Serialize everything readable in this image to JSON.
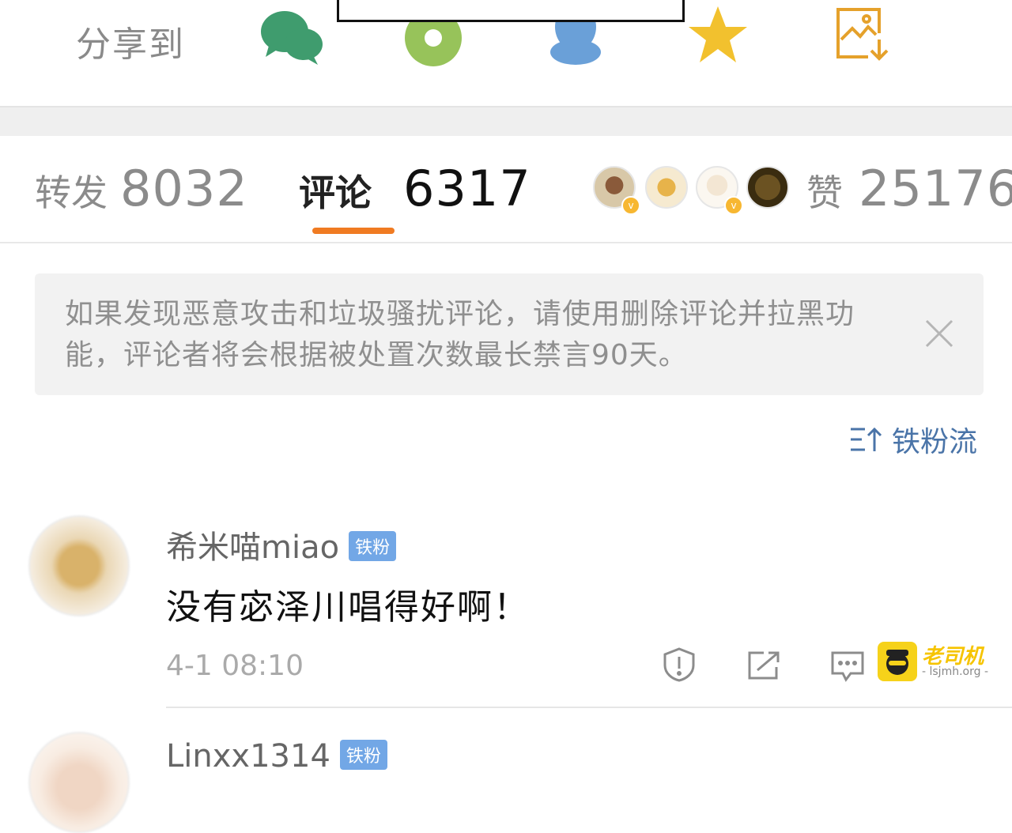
{
  "share": {
    "label": "分享到",
    "icons": [
      "wechat-icon",
      "moments-icon",
      "qq-icon",
      "favorite-star-icon",
      "save-image-icon"
    ]
  },
  "stats": {
    "reposts_label": "转发",
    "reposts_count": "8032",
    "comments_label": "评论",
    "comments_count": "6317",
    "likes_label": "赞",
    "likes_count": "25176",
    "active_tab": "comments",
    "accent_color": "#f07b22"
  },
  "notice": {
    "text": "如果发现恶意攻击和垃圾骚扰评论，请使用删除评论并拉黑功能，评论者将会根据被处置次数最长禁言90天。"
  },
  "sort": {
    "label": "铁粉流"
  },
  "comments": [
    {
      "username": "希米喵miao",
      "badge": "铁粉",
      "text": "没有宓泽川唱得好啊！",
      "time": "4-1 08:10"
    },
    {
      "username": "Linxx1314",
      "badge": "铁粉"
    }
  ],
  "watermark": {
    "brand": "老司机",
    "domain": "- lsjmh.org -"
  }
}
